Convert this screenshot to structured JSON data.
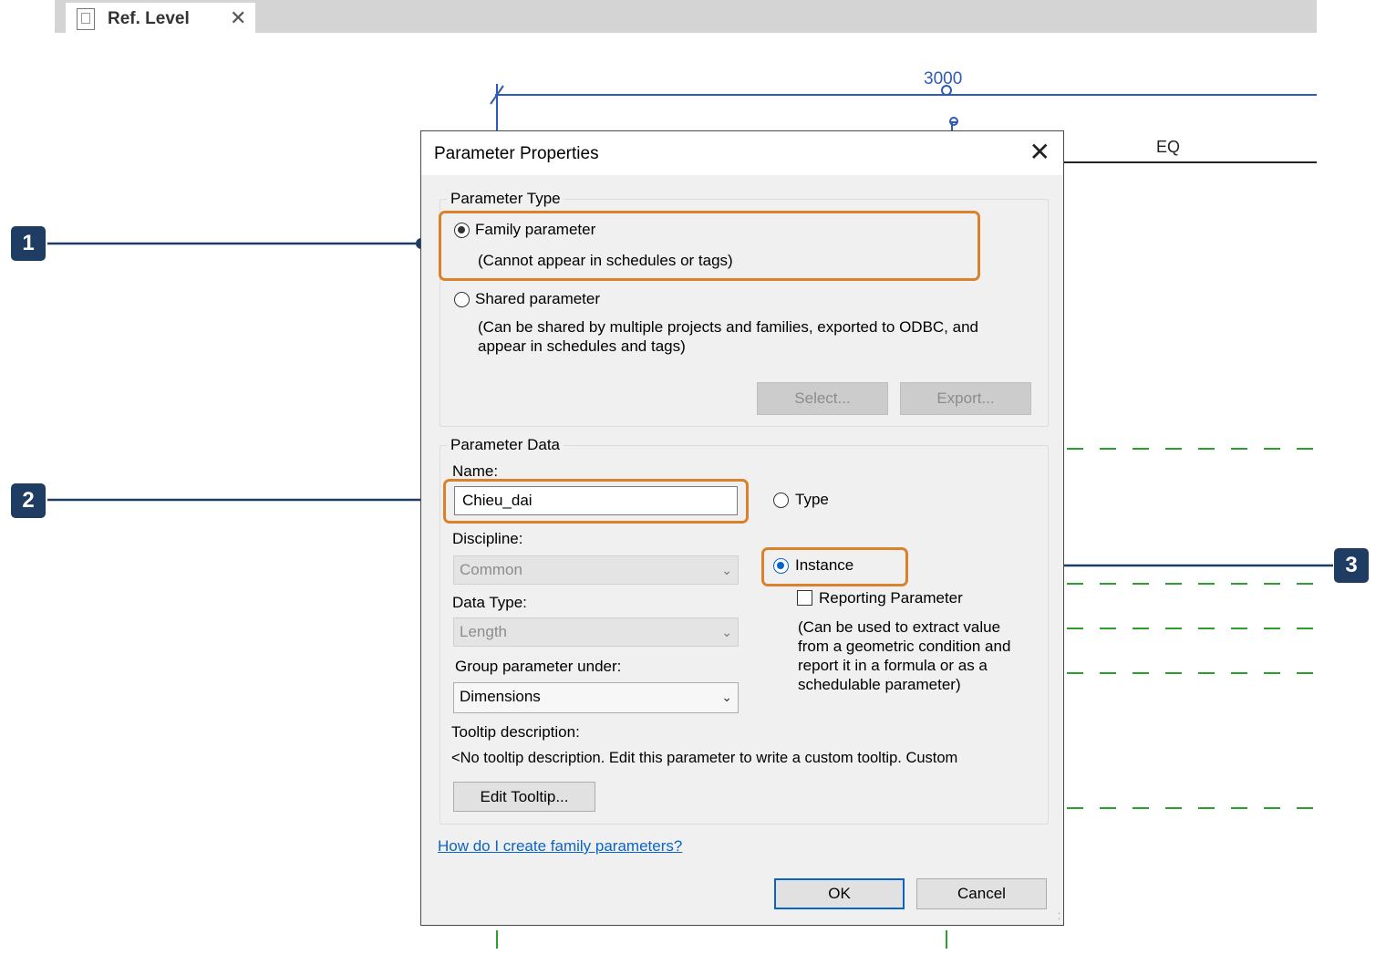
{
  "tab": {
    "title": "Ref. Level",
    "close": "✕"
  },
  "drawing": {
    "dimension_value": "3000",
    "eq_label": "EQ"
  },
  "dialog": {
    "title": "Parameter Properties",
    "close": "✕",
    "parameter_type": {
      "legend": "Parameter Type",
      "family_parameter": {
        "label": "Family parameter",
        "note": "(Cannot appear in schedules or tags)",
        "selected": true
      },
      "shared_parameter": {
        "label": "Shared parameter",
        "note": "(Can be shared by multiple projects and families, exported to ODBC, and appear in schedules and tags)",
        "selected": false
      },
      "select_button": "Select...",
      "export_button": "Export..."
    },
    "parameter_data": {
      "legend": "Parameter Data",
      "name_label": "Name:",
      "name_value": "Chieu_dai",
      "discipline_label": "Discipline:",
      "discipline_value": "Common",
      "data_type_label": "Data Type:",
      "data_type_value": "Length",
      "group_label": "Group parameter under:",
      "group_value": "Dimensions",
      "tooltip_label": "Tooltip description:",
      "tooltip_value": "<No tooltip description. Edit this parameter to write a custom tooltip. Custom",
      "edit_tooltip_button": "Edit Tooltip...",
      "type_option": "Type",
      "instance_option": "Instance",
      "reporting_label": "Reporting Parameter",
      "reporting_note": "(Can be used to extract value from a geometric condition and report it in a formula or as a schedulable parameter)"
    },
    "help_link": "How do I create family parameters?",
    "ok_button": "OK",
    "cancel_button": "Cancel"
  },
  "callouts": [
    "1",
    "2",
    "3"
  ],
  "colors": {
    "callout": "#1f3d63",
    "highlight": "#d9822b",
    "ref_line": "#2e5bb8",
    "dashed": "#2ca02c",
    "link": "#0a64c8"
  }
}
